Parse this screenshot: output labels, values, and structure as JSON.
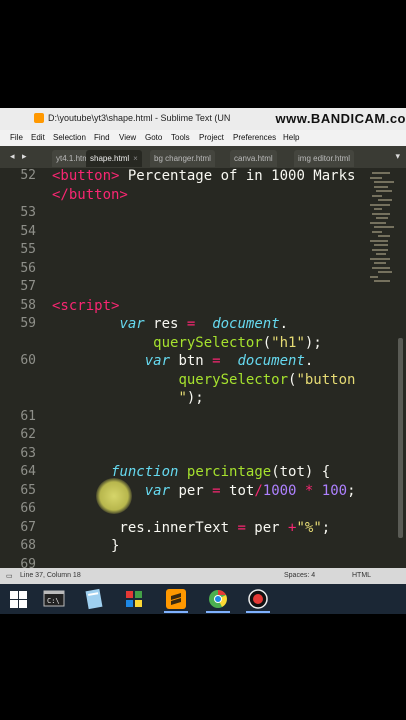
{
  "window": {
    "title": "D:\\youtube\\yt3\\shape.html - Sublime Text (UN",
    "recorder_watermark": "www.BANDICAM.co"
  },
  "menu": [
    "File",
    "Edit",
    "Selection",
    "Find",
    "View",
    "Goto",
    "Tools",
    "Project",
    "Preferences",
    "Help"
  ],
  "tabs": [
    {
      "label": "yt4.1.htm",
      "active": false
    },
    {
      "label": "shape.html",
      "active": true
    },
    {
      "label": "bg changer.html",
      "active": false
    },
    {
      "label": "canva.html",
      "active": false
    },
    {
      "label": "img editor.html",
      "active": false
    }
  ],
  "code_lines": [
    {
      "n": "52",
      "parts": [
        [
          "tag",
          "<button>"
        ],
        [
          "t",
          " Percentage of in 1000 Marks"
        ]
      ]
    },
    {
      "n": "",
      "parts": [
        [
          "tag",
          "</button>"
        ]
      ]
    },
    {
      "n": "53",
      "parts": []
    },
    {
      "n": "54",
      "parts": []
    },
    {
      "n": "55",
      "parts": []
    },
    {
      "n": "56",
      "parts": []
    },
    {
      "n": "57",
      "parts": []
    },
    {
      "n": "58",
      "parts": [
        [
          "tag",
          "<script>"
        ]
      ]
    },
    {
      "n": "59",
      "parts": [
        [
          "t",
          "        "
        ],
        [
          "kw",
          "var"
        ],
        [
          "t",
          " res "
        ],
        [
          "op",
          "="
        ],
        [
          "t",
          "  "
        ],
        [
          "kw",
          "document"
        ],
        [
          "t",
          "."
        ]
      ]
    },
    {
      "n": "",
      "parts": [
        [
          "t",
          "            "
        ],
        [
          "fn",
          "querySelector"
        ],
        [
          "t",
          "("
        ],
        [
          "str",
          "\"h1\""
        ],
        [
          "t",
          ");"
        ]
      ]
    },
    {
      "n": "60",
      "parts": [
        [
          "t",
          "           "
        ],
        [
          "kw",
          "var"
        ],
        [
          "t",
          " btn "
        ],
        [
          "op",
          "="
        ],
        [
          "t",
          "  "
        ],
        [
          "kw",
          "document"
        ],
        [
          "t",
          "."
        ]
      ]
    },
    {
      "n": "",
      "parts": [
        [
          "t",
          "               "
        ],
        [
          "fn",
          "querySelector"
        ],
        [
          "t",
          "("
        ],
        [
          "str",
          "\"button"
        ]
      ]
    },
    {
      "n": "",
      "parts": [
        [
          "t",
          "               "
        ],
        [
          "str",
          "\""
        ],
        [
          "t",
          ");"
        ]
      ]
    },
    {
      "n": "61",
      "parts": []
    },
    {
      "n": "62",
      "parts": []
    },
    {
      "n": "63",
      "parts": []
    },
    {
      "n": "64",
      "parts": [
        [
          "t",
          "       "
        ],
        [
          "kw",
          "function"
        ],
        [
          "t",
          " "
        ],
        [
          "fn",
          "percintage"
        ],
        [
          "t",
          "(tot) {"
        ]
      ]
    },
    {
      "n": "65",
      "parts": [
        [
          "t",
          "           "
        ],
        [
          "kw",
          "var"
        ],
        [
          "t",
          " per "
        ],
        [
          "op",
          "="
        ],
        [
          "t",
          " tot"
        ],
        [
          "op",
          "/"
        ],
        [
          "num",
          "1000"
        ],
        [
          "t",
          " "
        ],
        [
          "op",
          "*"
        ],
        [
          "t",
          " "
        ],
        [
          "num",
          "100"
        ],
        [
          "t",
          ";"
        ]
      ]
    },
    {
      "n": "66",
      "parts": []
    },
    {
      "n": "67",
      "parts": [
        [
          "t",
          "        res.innerText "
        ],
        [
          "op",
          "="
        ],
        [
          "t",
          " per "
        ],
        [
          "op",
          "+"
        ],
        [
          "str",
          "\"%\""
        ],
        [
          "t",
          ";"
        ]
      ]
    },
    {
      "n": "68",
      "parts": [
        [
          "t",
          "       }"
        ]
      ]
    },
    {
      "n": "69",
      "parts": []
    }
  ],
  "status": {
    "position": "Line 37, Column 18",
    "indent": "Spaces: 4",
    "syntax": "HTML"
  },
  "taskbar_icons": [
    "windows-start-icon",
    "terminal-icon",
    "notepad-icon",
    "paint-icon",
    "sublime-text-icon",
    "chrome-icon",
    "record-icon"
  ]
}
